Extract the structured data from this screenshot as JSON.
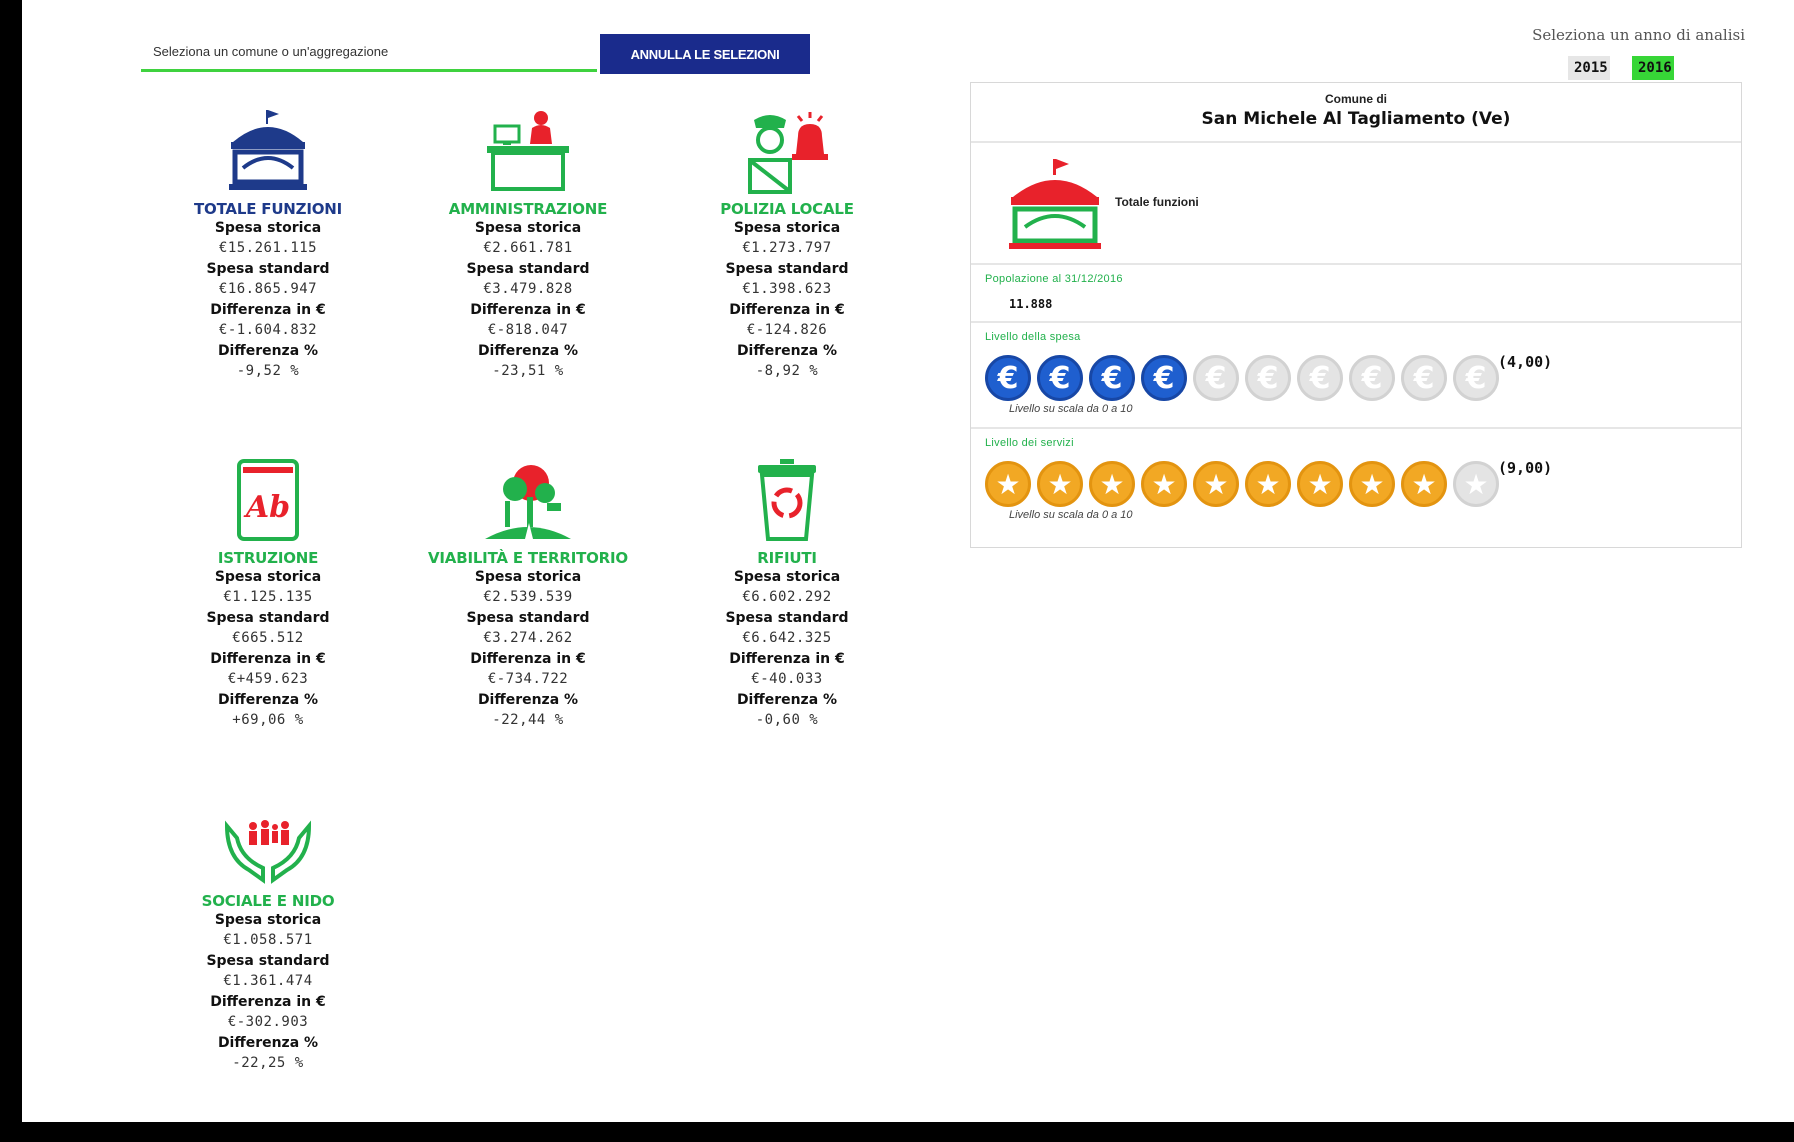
{
  "search": {
    "placeholder": "Seleziona un comune o un'aggregazione"
  },
  "clear_button": "ANNULLA LE SELEZIONI",
  "functions": [
    {
      "title": "TOTALE FUNZIONI",
      "icon": "town-hall-icon",
      "storica": "€15.261.115",
      "standard": "€16.865.947",
      "diff_eur": "€-1.604.832",
      "diff_pct": "-9,52 %"
    },
    {
      "title": "AMMINISTRAZIONE",
      "icon": "office-desk-icon",
      "storica": "€2.661.781",
      "standard": "€3.479.828",
      "diff_eur": "€-818.047",
      "diff_pct": "-23,51 %"
    },
    {
      "title": "POLIZIA LOCALE",
      "icon": "police-officer-icon",
      "storica": "€1.273.797",
      "standard": "€1.398.623",
      "diff_eur": "€-124.826",
      "diff_pct": "-8,92 %"
    },
    {
      "title": "ISTRUZIONE",
      "icon": "school-book-icon",
      "storica": "€1.125.135",
      "standard": "€665.512",
      "diff_eur": "€+459.623",
      "diff_pct": "+69,06 %"
    },
    {
      "title": "VIABILITÀ E TERRITORIO",
      "icon": "tree-road-icon",
      "storica": "€2.539.539",
      "standard": "€3.274.262",
      "diff_eur": "€-734.722",
      "diff_pct": "-22,44 %"
    },
    {
      "title": "RIFIUTI",
      "icon": "recycle-bin-icon",
      "storica": "€6.602.292",
      "standard": "€6.642.325",
      "diff_eur": "€-40.033",
      "diff_pct": "-0,60 %"
    },
    {
      "title": "SOCIALE E NIDO",
      "icon": "caring-hands-icon",
      "storica": "€1.058.571",
      "standard": "€1.361.474",
      "diff_eur": "€-302.903",
      "diff_pct": "-22,25 %"
    }
  ],
  "labels": {
    "storica": "Spesa storica",
    "standard": "Spesa standard",
    "diff_eur": "Differenza in €",
    "diff_pct": "Differenza %"
  },
  "year_selector": {
    "label": "Seleziona un anno di analisi",
    "years": [
      "2015",
      "2016"
    ],
    "selected": "2016"
  },
  "panel": {
    "subtitle": "Comune di",
    "name": "San Michele Al Tagliamento (Ve)",
    "function": "Totale funzioni",
    "population_label": "Popolazione al 31/12/2016",
    "population": "11.888",
    "spending_label": "Livello della spesa",
    "spending_level": 4,
    "spending_score": "(4,00)",
    "services_label": "Livello dei servizi",
    "services_level": 9,
    "services_score": "(9,00)",
    "scale_note": "Livello su scala da 0 a 10"
  },
  "colors": {
    "accent_blue": "#1a2b8c",
    "accent_green": "#22b14c",
    "coin": "#1f5fcf",
    "star": "#f2a824"
  }
}
